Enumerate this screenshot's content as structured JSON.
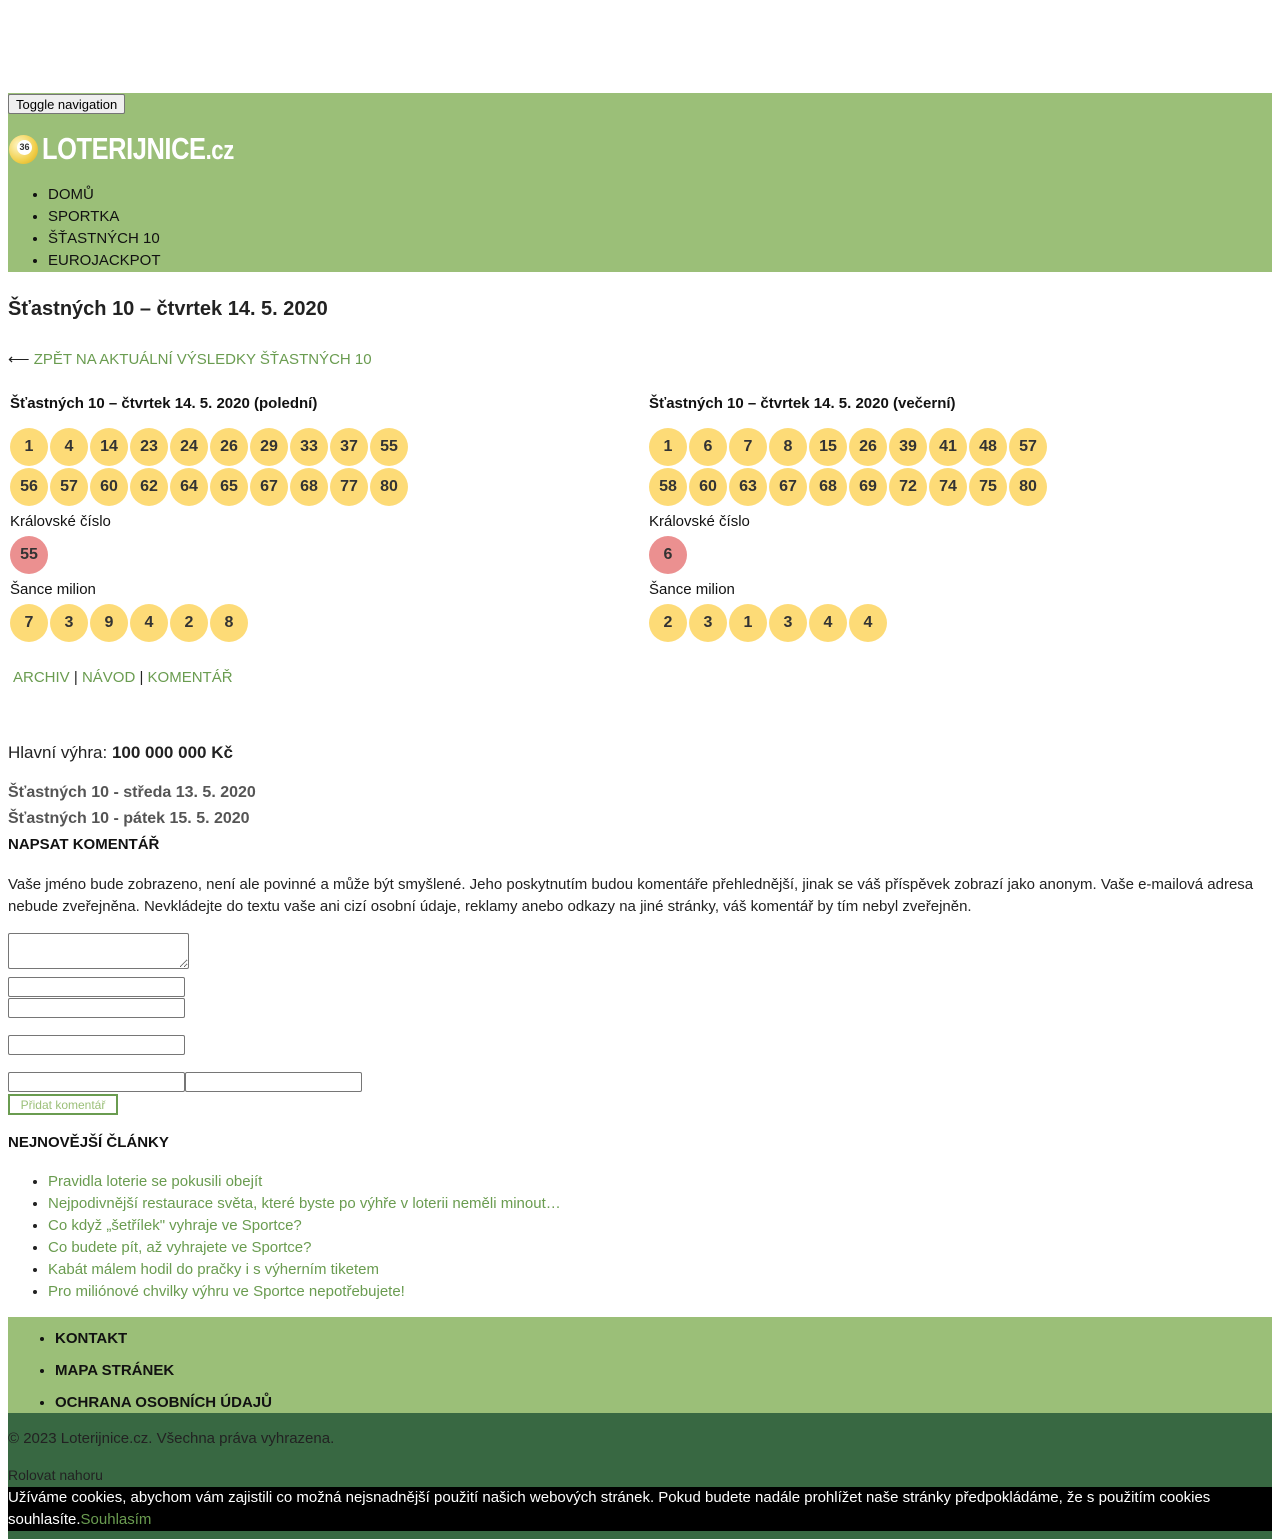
{
  "header": {
    "toggle_label": "Toggle navigation",
    "logo_ball_number": "36",
    "logo_main": "LOTERIJNICE",
    "logo_tld": ".cz",
    "nav": [
      "DOMŮ",
      "SPORTKA",
      "ŠŤASTNÝCH 10",
      "EUROJACKPOT"
    ]
  },
  "page": {
    "title": "Šťastných 10 – čtvrtek 14. 5. 2020",
    "back_arrow": "⟵",
    "back_link": "ZPĚT NA AKTUÁLNÍ VÝSLEDKY ŠŤASTNÝCH 10"
  },
  "draws": [
    {
      "title": "Šťastných 10 – čtvrtek 14. 5. 2020 (polední)",
      "numbers": [
        "1",
        "4",
        "14",
        "23",
        "24",
        "26",
        "29",
        "33",
        "37",
        "55",
        "56",
        "57",
        "60",
        "62",
        "64",
        "65",
        "67",
        "68",
        "77",
        "80"
      ],
      "royal_label": "Královské číslo",
      "royal": "55",
      "chance_label": "Šance milion",
      "chance": [
        "7",
        "3",
        "9",
        "4",
        "2",
        "8"
      ]
    },
    {
      "title": "Šťastných 10 – čtvrtek 14. 5. 2020 (večerní)",
      "numbers": [
        "1",
        "6",
        "7",
        "8",
        "15",
        "26",
        "39",
        "41",
        "48",
        "57",
        "58",
        "60",
        "63",
        "67",
        "68",
        "69",
        "72",
        "74",
        "75",
        "80"
      ],
      "royal_label": "Královské číslo",
      "royal": "6",
      "chance_label": "Šance milion",
      "chance": [
        "2",
        "3",
        "1",
        "3",
        "4",
        "4"
      ]
    }
  ],
  "links": {
    "archive": "ARCHIV",
    "guide": "NÁVOD",
    "comment": "KOMENTÁŘ",
    "sep": "|"
  },
  "jackpot": {
    "label": "Hlavní výhra:",
    "value": "100 000 000 Kč"
  },
  "prevnext": {
    "prev": "Šťastných 10 - středa 13. 5. 2020",
    "next": "Šťastných 10 - pátek 15. 5. 2020"
  },
  "comment_form": {
    "title": "NAPSAT KOMENTÁŘ",
    "note": "Vaše jméno bude zobrazeno, není ale povinné a může být smyšlené. Jeho poskytnutím budou komentáře přehlednější, jinak se váš příspěvek zobrazí jako anonym. Vaše e-mailová adresa nebude zveřejněna. Nevkládejte do textu vaše ani cizí osobní údaje, reklamy anebo odkazy na jiné stránky, váš komentář by tím nebyl zveřejněn.",
    "submit": "Přidat komentář"
  },
  "articles": {
    "title": "NEJNOVĚJŠÍ ČLÁNKY",
    "items": [
      "Pravidla loterie se pokusili obejít",
      "Nejpodivnější restaurace světa, které byste po výhře v loterii neměli minout…",
      "Co když „šetřílek\" vyhraje ve Sportce?",
      "Co budete pít, až vyhrajete ve Sportce?",
      "Kabát málem hodil do pračky i s výherním tiketem",
      "Pro miliónové chvilky výhru ve Sportce nepotřebujete!"
    ]
  },
  "footer": {
    "nav": [
      "KONTAKT",
      "MAPA STRÁNEK",
      "OCHRANA OSOBNÍCH ÚDAJŮ"
    ],
    "copyright": "© 2023 Loterijnice.cz. Všechna práva vyhrazena.",
    "to_top": "Rolovat nahoru"
  },
  "cookie": {
    "text": "Užíváme cookies, abychom vám zajistili co možná nejsnadnější použití našich webových stránek. Pokud budete nadále prohlížet naše stránky předpokládáme, že s použitím cookies souhlasíte.",
    "agree": "Souhlasím"
  },
  "colors": {
    "header_green": "#9bbf78",
    "footer_dark": "#386842",
    "link_green": "#6a9c50",
    "ball_yellow": "#fddb77",
    "ball_red": "#eb9090"
  }
}
